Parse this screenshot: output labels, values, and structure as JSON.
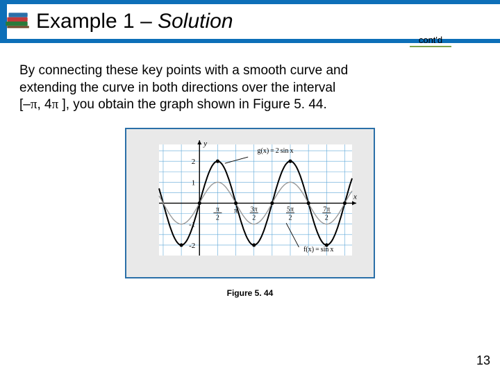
{
  "header": {
    "title_plain": "Example 1 – ",
    "title_italic": "Solution",
    "contd": "cont'd"
  },
  "body": {
    "line1": "By connecting these key points with a smooth curve and",
    "line2": "extending the curve in both directions over the interval",
    "line3a": "[–",
    "line3b": ", 4",
    "line3c": " ], you obtain the graph shown in Figure 5. 44."
  },
  "figure": {
    "caption": "Figure 5. 44"
  },
  "page_number": "13",
  "chart_data": {
    "type": "line",
    "title": "",
    "xlabel": "x",
    "ylabel": "y",
    "xlim": [
      -3.5,
      13.2
    ],
    "ylim": [
      -2.5,
      2.8
    ],
    "x_ticks": [
      "π/2",
      "π",
      "3π/2",
      "5π/2",
      "7π/2"
    ],
    "y_ticks": [
      -2,
      -1,
      1,
      2
    ],
    "series": [
      {
        "name": "g(x) = 2 sin x",
        "amplitude": 2,
        "x": [
          -3.1416,
          -1.5708,
          0,
          1.5708,
          3.1416,
          4.7124,
          6.2832,
          7.854,
          9.4248,
          10.9956,
          12.5664
        ],
        "y": [
          0,
          -2,
          0,
          2,
          0,
          -2,
          0,
          2,
          0,
          -2,
          0
        ],
        "color": "#000000"
      },
      {
        "name": "f(x) = sin x",
        "amplitude": 1,
        "x": [
          -3.1416,
          -1.5708,
          0,
          1.5708,
          3.1416,
          4.7124,
          6.2832,
          7.854,
          9.4248,
          10.9956,
          12.5664
        ],
        "y": [
          0,
          -1,
          0,
          1,
          0,
          -1,
          0,
          1,
          0,
          -1,
          0
        ],
        "color": "#999999"
      }
    ],
    "annotations": [
      {
        "text": "g(x) = 2 sin x",
        "x": 5.0,
        "y": 2.4
      },
      {
        "text": "f(x) = sin x",
        "x": 9.0,
        "y": -2.3
      }
    ],
    "key_points": [
      {
        "x": -1.5708,
        "y": -2
      },
      {
        "x": 0,
        "y": 0
      },
      {
        "x": 1.5708,
        "y": 2
      },
      {
        "x": 3.1416,
        "y": 0
      },
      {
        "x": 4.7124,
        "y": -2
      },
      {
        "x": 6.2832,
        "y": 0
      },
      {
        "x": 7.854,
        "y": 2
      },
      {
        "x": 9.4248,
        "y": 0
      },
      {
        "x": 10.9956,
        "y": -2
      },
      {
        "x": 12.5664,
        "y": 0
      }
    ]
  }
}
